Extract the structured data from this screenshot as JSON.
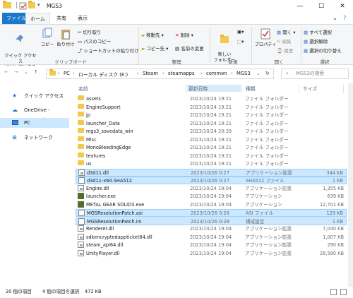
{
  "window": {
    "title": "MGS3",
    "min": "—",
    "max": "☐",
    "close": "✕"
  },
  "tabs": [
    "ファイル",
    "ホーム",
    "共有",
    "表示"
  ],
  "ribbon": {
    "clipboard": {
      "pin": "クイック アクセス\nにピン留めする",
      "copy": "コピー",
      "paste": "貼り付け",
      "cut": "切り取り",
      "copy_path": "パスのコピー",
      "paste_shortcut": "ショートカットの貼り付け",
      "label": "クリップボード"
    },
    "organize": {
      "move_to": "移動先 ▾",
      "copy_to": "コピー先 ▾",
      "delete": "削除 ▾",
      "rename": "名前の変更",
      "label": "整理"
    },
    "new": {
      "new_folder": "新しい\nフォルダー",
      "label": "新規"
    },
    "open": {
      "properties": "プロパティ",
      "open": "開く ▾",
      "edit": "編集",
      "history": "履歴",
      "label": "開く"
    },
    "select": {
      "select_all": "すべて選択",
      "select_none": "選択解除",
      "invert": "選択の切り替え",
      "label": "選択"
    }
  },
  "address": {
    "crumbs": [
      "PC",
      "ローカル ディスク (E:)",
      "Steam",
      "steamapps",
      "common",
      "MGS3"
    ],
    "search_placeholder": "MGS3の検索"
  },
  "nav": [
    {
      "label": "クイック アクセス",
      "icon": "star-icon"
    },
    {
      "label": "OneDrive - Personal",
      "icon": "cloud-icon"
    },
    {
      "label": "PC",
      "icon": "pc-icon"
    },
    {
      "label": "ネットワーク",
      "icon": "network-icon"
    }
  ],
  "columns": {
    "name": "名前",
    "date": "更新日時",
    "type": "種類",
    "size": "サイズ"
  },
  "files": [
    {
      "name": "assets",
      "date": "2023/10/24 19:21",
      "type": "ファイル フォルダー",
      "size": "",
      "kind": "folder",
      "selected": false
    },
    {
      "name": "EngineSupport",
      "date": "2023/10/24 19:21",
      "type": "ファイル フォルダー",
      "size": "",
      "kind": "folder",
      "selected": false
    },
    {
      "name": "jp",
      "date": "2023/10/24 19:21",
      "type": "ファイル フォルダー",
      "size": "",
      "kind": "folder",
      "selected": false
    },
    {
      "name": "launcher_Data",
      "date": "2023/10/24 19:21",
      "type": "ファイル フォルダー",
      "size": "",
      "kind": "folder",
      "selected": false
    },
    {
      "name": "mgs3_savedata_win",
      "date": "2023/10/24 20:39",
      "type": "ファイル フォルダー",
      "size": "",
      "kind": "folder",
      "selected": false
    },
    {
      "name": "Misc",
      "date": "2023/10/24 19:21",
      "type": "ファイル フォルダー",
      "size": "",
      "kind": "folder",
      "selected": false
    },
    {
      "name": "MonoBleedingEdge",
      "date": "2023/10/24 19:21",
      "type": "ファイル フォルダー",
      "size": "",
      "kind": "folder",
      "selected": false
    },
    {
      "name": "textures",
      "date": "2023/10/24 19:21",
      "type": "ファイル フォルダー",
      "size": "",
      "kind": "folder",
      "selected": false
    },
    {
      "name": "us",
      "date": "2023/10/24 19:21",
      "type": "ファイル フォルダー",
      "size": "",
      "kind": "folder",
      "selected": false
    },
    {
      "name": "d3d11.dll",
      "date": "2023/10/26 0:27",
      "type": "アプリケーション拡張",
      "size": "344 KB",
      "kind": "dll",
      "selected": true
    },
    {
      "name": "d3d11-x64.SHA512",
      "date": "2023/10/26 0:27",
      "type": "SHA512 ファイル",
      "size": "1 KB",
      "kind": "file",
      "selected": true
    },
    {
      "name": "Engine.dll",
      "date": "2023/10/24 19:04",
      "type": "アプリケーション拡張",
      "size": "1,355 KB",
      "kind": "dll",
      "selected": false
    },
    {
      "name": "launcher.exe",
      "date": "2023/10/24 19:04",
      "type": "アプリケーション",
      "size": "639 KB",
      "kind": "exe",
      "selected": false
    },
    {
      "name": "METAL GEAR SOLID3.exe",
      "date": "2023/10/24 19:04",
      "type": "アプリケーション",
      "size": "12,701 KB",
      "kind": "exe",
      "selected": false
    },
    {
      "name": "MGSResolutionPatch.asi",
      "date": "2023/10/26 0:28",
      "type": "ASI ファイル",
      "size": "129 KB",
      "kind": "file",
      "selected": true
    },
    {
      "name": "MGSResolutionPatch.ini",
      "date": "2023/10/26 0:28",
      "type": "構成設定",
      "size": "1 KB",
      "kind": "file",
      "selected": true
    },
    {
      "name": "Renderer.dll",
      "date": "2023/10/24 19:04",
      "type": "アプリケーション拡張",
      "size": "7,040 KB",
      "kind": "dll",
      "selected": false
    },
    {
      "name": "sdkencryptedappticket64.dll",
      "date": "2023/10/24 19:04",
      "type": "アプリケーション拡張",
      "size": "1,007 KB",
      "kind": "dll",
      "selected": false
    },
    {
      "name": "steam_api64.dll",
      "date": "2023/10/24 19:04",
      "type": "アプリケーション拡張",
      "size": "290 KB",
      "kind": "dll",
      "selected": false
    },
    {
      "name": "UnityPlayer.dll",
      "date": "2023/10/24 19:04",
      "type": "アプリケーション拡張",
      "size": "28,580 KB",
      "kind": "dll",
      "selected": false
    }
  ],
  "status": {
    "count": "20 個の項目",
    "selected": "4 個の項目を選択",
    "size": "472 KB"
  },
  "colors": {
    "accent": "#1979ca",
    "selection": "#cce8ff",
    "folder": "#f2c94c"
  }
}
